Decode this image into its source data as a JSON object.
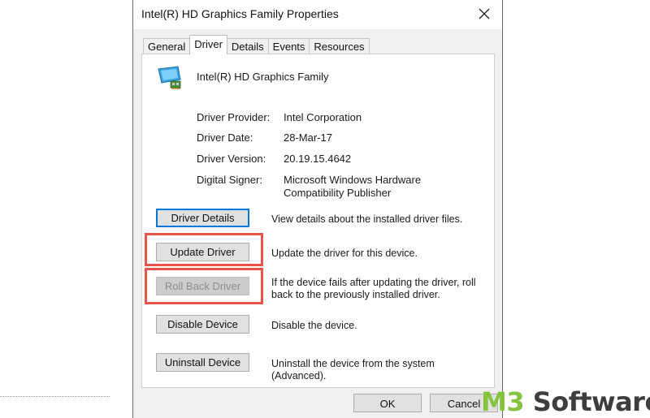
{
  "window": {
    "title": "Intel(R) HD Graphics Family Properties",
    "close_glyph": "✕"
  },
  "tabs": [
    {
      "label": "General",
      "active": false
    },
    {
      "label": "Driver",
      "active": true
    },
    {
      "label": "Details",
      "active": false
    },
    {
      "label": "Events",
      "active": false
    },
    {
      "label": "Resources",
      "active": false
    }
  ],
  "device": {
    "name": "Intel(R) HD Graphics Family",
    "icon": "display-adapter-icon"
  },
  "properties": [
    {
      "label": "Driver Provider:",
      "value": "Intel Corporation"
    },
    {
      "label": "Driver Date:",
      "value": "28-Mar-17"
    },
    {
      "label": "Driver Version:",
      "value": "20.19.15.4642"
    },
    {
      "label": "Digital Signer:",
      "value": "Microsoft Windows Hardware Compatibility Publisher"
    }
  ],
  "actions": [
    {
      "label": "Driver Details",
      "description": "View details about the installed driver files.",
      "enabled": true
    },
    {
      "label": "Update Driver",
      "description": "Update the driver for this device.",
      "enabled": true
    },
    {
      "label": "Roll Back Driver",
      "description": "If the device fails after updating the driver, roll back to the previously installed driver.",
      "enabled": false
    },
    {
      "label": "Disable Device",
      "description": "Disable the device.",
      "enabled": true
    },
    {
      "label": "Uninstall Device",
      "description": "Uninstall the device from the system (Advanced).",
      "enabled": true
    }
  ],
  "footer": {
    "ok_label": "OK",
    "cancel_label": "Cancel"
  },
  "watermark": {
    "brand_prefix": "M3",
    "brand_suffix": " Software",
    "accent_color": "#86c440"
  },
  "colors": {
    "highlight": "#e8534a",
    "focus": "#0078d7"
  }
}
